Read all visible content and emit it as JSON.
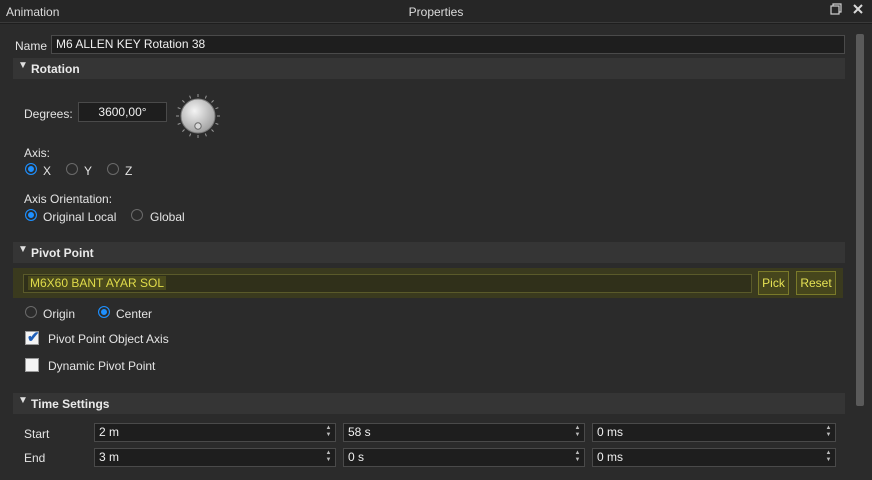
{
  "window": {
    "left_title": "Animation",
    "center_title": "Properties",
    "restore_icon": "restore-window-icon",
    "close_icon": "close-icon"
  },
  "name": {
    "label": "Name",
    "value": "M6 ALLEN KEY Rotation 38"
  },
  "rotation": {
    "title": "Rotation",
    "degrees_label": "Degrees:",
    "degrees_value": "3600,00°",
    "axis_label": "Axis:",
    "axis_options": [
      "X",
      "Y",
      "Z"
    ],
    "axis_selected": "X",
    "orientation_label": "Axis Orientation:",
    "orientation_options": [
      "Original Local",
      "Global"
    ],
    "orientation_selected": "Original Local"
  },
  "pivot": {
    "title": "Pivot Point",
    "object_value": "M6X60 BANT AYAR SOL",
    "pick_label": "Pick",
    "reset_label": "Reset",
    "mode_options": [
      "Origin",
      "Center"
    ],
    "mode_selected": "Center",
    "object_axis_label": "Pivot Point Object Axis",
    "object_axis_checked": true,
    "dynamic_label": "Dynamic Pivot Point",
    "dynamic_checked": false
  },
  "time": {
    "title": "Time Settings",
    "start_label": "Start",
    "start_values": [
      "2 m",
      "58 s",
      "0 ms"
    ],
    "end_label": "End",
    "end_values": [
      "3 m",
      "0 s",
      "0 ms"
    ]
  },
  "colors": {
    "accent": "#1e90ff",
    "highlight_text": "#e0dc4a",
    "section_bg": "#353535"
  }
}
